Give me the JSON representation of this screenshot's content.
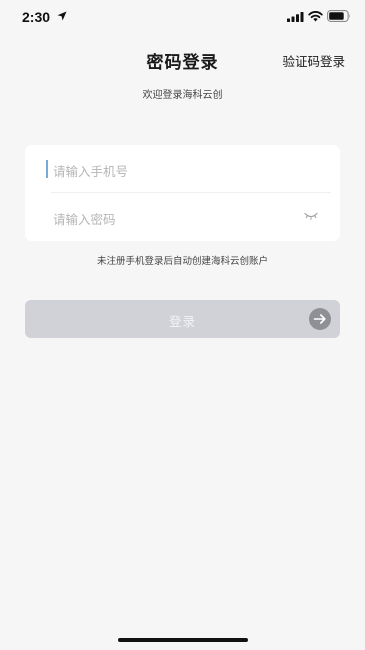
{
  "status_bar": {
    "time": "2:30"
  },
  "header": {
    "title": "密码登录",
    "switch_label": "验证码登录"
  },
  "welcome_text": "欢迎登录海科云创",
  "form": {
    "phone_placeholder": "请输入手机号",
    "password_placeholder": "请输入密码"
  },
  "hint_text": "未注册手机登录后自动创建海科云创账户",
  "login_button": {
    "label": "登录"
  },
  "colors": {
    "background": "#f6f6f7",
    "button_disabled": "#d0d2d8",
    "cursor": "#7aa9d6",
    "arrow_circle": "#8e9096"
  }
}
